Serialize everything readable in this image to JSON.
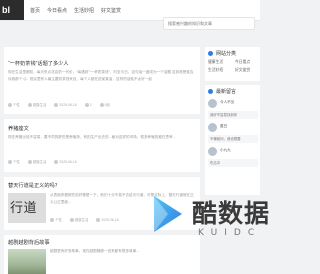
{
  "header": {
    "logo_text": "bl",
    "nav": [
      "首页",
      "今日看点",
      "生活妙招",
      "好文鉴赏"
    ],
    "search_placeholder": "搜索感兴趣的知识和文章"
  },
  "articles": [
    {
      "title": "“一杯奶茶钱”话题了多少人",
      "excerpt": "现在生活里都知，每天来点花店奶一代价，“每遇到”“一杯奶茶钱”，时至今日，这句话一度成为一个话题 这到底是谁告诉我那个 Q：现实里有人最主要奶茶钱来自，每个人都在说某某省，这样的话就不太好一起",
      "meta": [
        "个性",
        "健康生活",
        "2025-06-16",
        "2",
        "0阅"
      ]
    },
    {
      "title": "养猪座文",
      "excerpt": "现在养猪比较不容易，要不同的那些是养殖场，有的生产出去的...面对这样的市场，很多养殖的都在思考...",
      "meta": [
        "个性",
        "健康生活",
        "2025-06-16"
      ]
    },
    {
      "title": "替天行道是正义的吗？",
      "excerpt": "从表面来看那些说好像是一下，他们十分不易不去给天行道，可是实际上，替天行道就在正义公正里面...",
      "meta": [
        "个性",
        "健康生活",
        "2025-06-16"
      ],
      "thumb_text": "行道"
    },
    {
      "title": "越剧越剧背后故事",
      "excerpt": "越剧里有好多故事，现在越剧随便一说来都有很多故事..."
    }
  ],
  "sidebar": {
    "categories_title": "网站分类",
    "categories": [
      "健康生活",
      "今日看点",
      "生活妙招",
      "好文鉴赏"
    ],
    "comments_title": "最新留言",
    "comments": [
      {
        "name": "今人不见",
        "text": "我好不容易找到你"
      },
      {
        "name": "墨白",
        "text": "不懂就问，我也想要"
      },
      {
        "name": "小九九",
        "text": "吃瓜中"
      }
    ]
  },
  "watermark": {
    "title": "酷数据",
    "subtitle": "KUIDC"
  },
  "colors": {
    "accent": "#2b7de9",
    "page_bg": "#f1f2f4"
  }
}
